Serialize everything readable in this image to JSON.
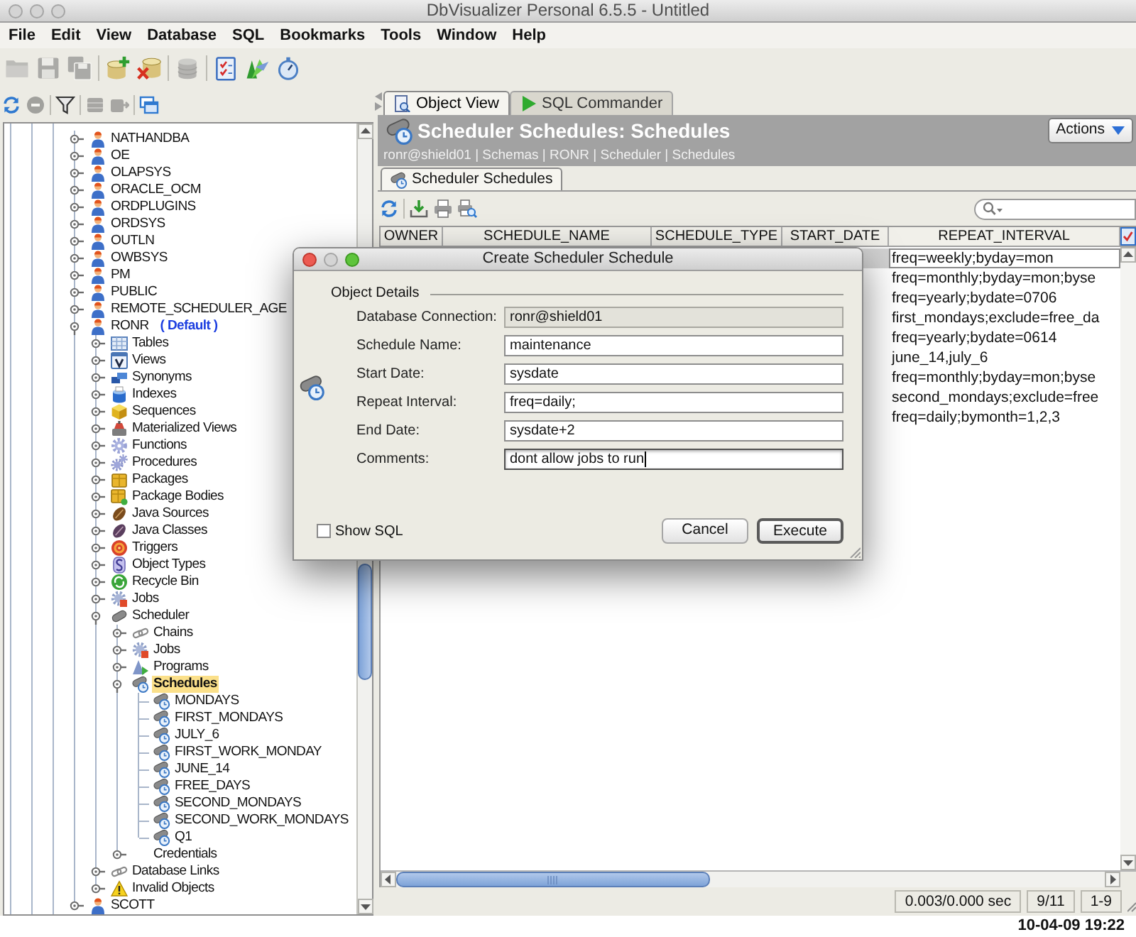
{
  "window": {
    "title": "DbVisualizer Personal 6.5.5 - Untitled",
    "active": false
  },
  "menu": [
    "File",
    "Edit",
    "View",
    "Database",
    "SQL",
    "Bookmarks",
    "Tools",
    "Window",
    "Help"
  ],
  "toolbar": [
    {
      "kind": "open",
      "disabled": true
    },
    {
      "kind": "save",
      "disabled": true
    },
    {
      "kind": "saveall",
      "disabled": true
    },
    {
      "kind": "separator"
    },
    {
      "kind": "connect",
      "disabled": false
    },
    {
      "kind": "disconnect",
      "disabled": false
    },
    {
      "kind": "separator"
    },
    {
      "kind": "database",
      "disabled": true
    },
    {
      "kind": "separator"
    },
    {
      "kind": "tasks",
      "disabled": false
    },
    {
      "kind": "flags",
      "disabled": false
    },
    {
      "kind": "stopwatch",
      "disabled": false
    }
  ],
  "navigator": {
    "toolbar": [
      {
        "kind": "refresh",
        "disabled": false
      },
      {
        "kind": "stop",
        "disabled": true
      },
      {
        "kind": "separator"
      },
      {
        "kind": "filter",
        "disabled": false
      },
      {
        "kind": "separator"
      },
      {
        "kind": "dbgrid",
        "disabled": true
      },
      {
        "kind": "dbarrow",
        "disabled": true
      },
      {
        "kind": "separator"
      },
      {
        "kind": "windows",
        "disabled": false
      }
    ],
    "tree": [
      {
        "label": "NATHANDBA",
        "kind": "schema",
        "expanded": false,
        "selected": false
      },
      {
        "label": "OE",
        "kind": "schema",
        "expanded": false,
        "selected": false
      },
      {
        "label": "OLAPSYS",
        "kind": "schema",
        "expanded": false,
        "selected": false
      },
      {
        "label": "ORACLE_OCM",
        "kind": "schema",
        "expanded": false,
        "selected": false
      },
      {
        "label": "ORDPLUGINS",
        "kind": "schema",
        "expanded": false,
        "selected": false
      },
      {
        "label": "ORDSYS",
        "kind": "schema",
        "expanded": false,
        "selected": false
      },
      {
        "label": "OUTLN",
        "kind": "schema",
        "expanded": false,
        "selected": false
      },
      {
        "label": "OWBSYS",
        "kind": "schema",
        "expanded": false,
        "selected": false
      },
      {
        "label": "PM",
        "kind": "schema",
        "expanded": false,
        "selected": false
      },
      {
        "label": "PUBLIC",
        "kind": "schema",
        "expanded": false,
        "selected": false
      },
      {
        "label": "REMOTE_SCHEDULER_AGE",
        "kind": "schema",
        "expanded": false,
        "selected": false
      },
      {
        "label": "RONR",
        "note": "( Default )",
        "kind": "schema",
        "expanded": true,
        "selected": false,
        "children": [
          {
            "label": "Tables",
            "kind": "tables",
            "expanded": false,
            "selected": false
          },
          {
            "label": "Views",
            "kind": "views",
            "expanded": false,
            "selected": false
          },
          {
            "label": "Synonyms",
            "kind": "synonyms",
            "expanded": false,
            "selected": false
          },
          {
            "label": "Indexes",
            "kind": "indexes",
            "expanded": false,
            "selected": false
          },
          {
            "label": "Sequences",
            "kind": "sequences",
            "expanded": false,
            "selected": false
          },
          {
            "label": "Materialized Views",
            "kind": "mviews",
            "expanded": false,
            "selected": false
          },
          {
            "label": "Functions",
            "kind": "functions",
            "expanded": false,
            "selected": false
          },
          {
            "label": "Procedures",
            "kind": "procedures",
            "expanded": false,
            "selected": false
          },
          {
            "label": "Packages",
            "kind": "packages",
            "expanded": false,
            "selected": false
          },
          {
            "label": "Package Bodies",
            "kind": "bodies",
            "expanded": false,
            "selected": false
          },
          {
            "label": "Java Sources",
            "kind": "javasources",
            "expanded": false,
            "selected": false
          },
          {
            "label": "Java Classes",
            "kind": "javaclasses",
            "expanded": false,
            "selected": false
          },
          {
            "label": "Triggers",
            "kind": "triggers",
            "expanded": false,
            "selected": false
          },
          {
            "label": "Object Types",
            "kind": "types",
            "expanded": false,
            "selected": false
          },
          {
            "label": "Recycle Bin",
            "kind": "recyclebin",
            "expanded": false,
            "selected": false
          },
          {
            "label": "Jobs",
            "kind": "jobs",
            "expanded": false,
            "selected": false
          },
          {
            "label": "Scheduler",
            "kind": "scheduler",
            "expanded": true,
            "selected": false,
            "children": [
              {
                "label": "Chains",
                "kind": "chains",
                "expanded": false,
                "selected": false
              },
              {
                "label": "Jobs",
                "kind": "jobs",
                "expanded": false,
                "selected": false
              },
              {
                "label": "Programs",
                "kind": "programs",
                "expanded": false,
                "selected": false
              },
              {
                "label": "Schedules",
                "kind": "schedules",
                "expanded": true,
                "selected": true,
                "children": [
                  {
                    "label": "MONDAYS",
                    "kind": "schedule",
                    "selected": false
                  },
                  {
                    "label": "FIRST_MONDAYS",
                    "kind": "schedule",
                    "selected": false
                  },
                  {
                    "label": "JULY_6",
                    "kind": "schedule",
                    "selected": false
                  },
                  {
                    "label": "FIRST_WORK_MONDAY",
                    "kind": "schedule",
                    "selected": false
                  },
                  {
                    "label": "JUNE_14",
                    "kind": "schedule",
                    "selected": false
                  },
                  {
                    "label": "FREE_DAYS",
                    "kind": "schedule",
                    "selected": false
                  },
                  {
                    "label": "SECOND_MONDAYS",
                    "kind": "schedule",
                    "selected": false
                  },
                  {
                    "label": "SECOND_WORK_MONDAYS",
                    "kind": "schedule",
                    "selected": false
                  },
                  {
                    "label": "Q1",
                    "kind": "schedule",
                    "selected": false
                  }
                ]
              },
              {
                "label": "Credentials",
                "kind": "credentials",
                "expanded": false,
                "selected": false
              }
            ]
          },
          {
            "label": "Database Links",
            "kind": "dblinks",
            "expanded": false,
            "selected": false
          },
          {
            "label": "Invalid Objects",
            "kind": "invalid",
            "expanded": false,
            "selected": false
          }
        ]
      },
      {
        "label": "SCOTT",
        "kind": "schema",
        "expanded": false,
        "selected": false
      }
    ]
  },
  "object_view": {
    "tabs": [
      {
        "label": "Object View",
        "kind": "object",
        "selected": true
      },
      {
        "label": "SQL Commander",
        "kind": "sql",
        "selected": false
      }
    ],
    "header": {
      "title": "Scheduler Schedules: Schedules",
      "breadcrumb": "ronr@shield01 | Schemas | RONR | Scheduler | Schedules",
      "actions": "Actions"
    },
    "subtabs": [
      {
        "label": "Scheduler Schedules",
        "selected": true
      }
    ],
    "toolbar": [
      {
        "kind": "refresh",
        "disabled": false
      },
      {
        "kind": "separator"
      },
      {
        "kind": "export",
        "disabled": false
      },
      {
        "kind": "print",
        "disabled": false
      },
      {
        "kind": "preview",
        "disabled": false
      }
    ],
    "table": {
      "columns": [
        "OWNER",
        "SCHEDULE_NAME",
        "SCHEDULE_TYPE",
        "START_DATE",
        "REPEAT_INTERVAL"
      ],
      "rows": [
        {
          "repeat_interval": "freq=weekly;byday=mon",
          "selected": true
        },
        {
          "repeat_interval": "freq=monthly;byday=mon;byse",
          "selected": false
        },
        {
          "repeat_interval": "freq=yearly;bydate=0706",
          "selected": false
        },
        {
          "repeat_interval": "first_mondays;exclude=free_da",
          "selected": false
        },
        {
          "repeat_interval": "freq=yearly;bydate=0614",
          "selected": false
        },
        {
          "repeat_interval": "june_14,july_6",
          "selected": false
        },
        {
          "repeat_interval": "freq=monthly;byday=mon;byse",
          "selected": false
        },
        {
          "repeat_interval": "second_mondays;exclude=free",
          "selected": false
        },
        {
          "repeat_interval": "freq=daily;bymonth=1,2,3",
          "selected": false
        }
      ]
    },
    "status": [
      "0.003/0.000 sec",
      "9/11",
      "1-9"
    ]
  },
  "dialog": {
    "title": "Create Scheduler Schedule",
    "active": true,
    "group": "Object Details",
    "fields": [
      {
        "label": "Database Connection:",
        "value": "ronr@shield01",
        "editable": false,
        "focused": false
      },
      {
        "label": "Schedule Name:",
        "value": "maintenance",
        "editable": true,
        "focused": false
      },
      {
        "label": "Start Date:",
        "value": "sysdate",
        "editable": true,
        "focused": false
      },
      {
        "label": "Repeat Interval:",
        "value": "freq=daily;",
        "editable": true,
        "focused": false
      },
      {
        "label": "End Date:",
        "value": "sysdate+2",
        "editable": true,
        "focused": false
      },
      {
        "label": "Comments:",
        "value": "dont allow jobs to run",
        "editable": true,
        "focused": true
      }
    ],
    "show_sql": {
      "label": "Show SQL",
      "checked": false
    },
    "buttons": [
      {
        "label": "Cancel",
        "default": false
      },
      {
        "label": "Execute",
        "default": true
      }
    ]
  },
  "timestamp": "10-04-09 19:22"
}
